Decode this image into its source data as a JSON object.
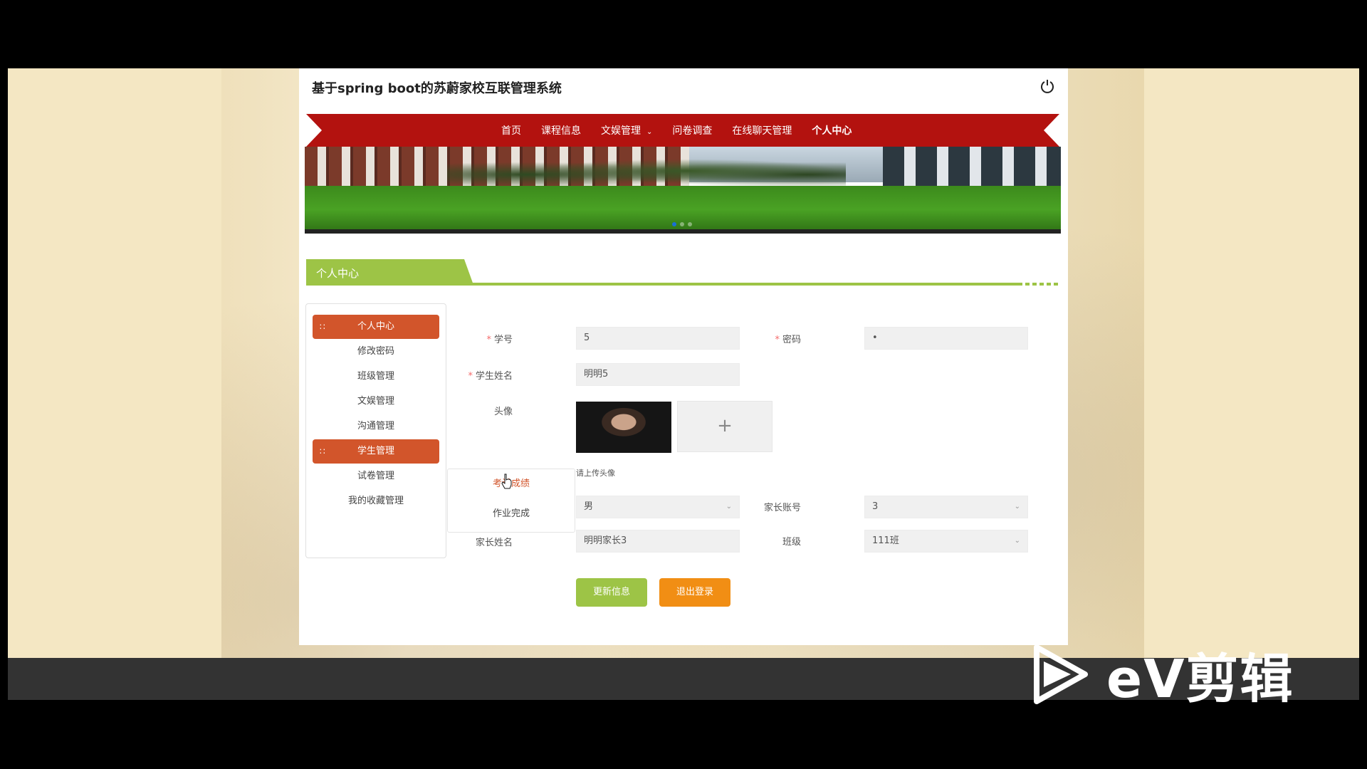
{
  "app": {
    "title": "基于spring boot的苏蔚家校互联管理系统"
  },
  "nav": {
    "items": [
      {
        "label": "首页",
        "active": false,
        "has_dropdown": false
      },
      {
        "label": "课程信息",
        "active": false,
        "has_dropdown": false
      },
      {
        "label": "文娱管理",
        "active": false,
        "has_dropdown": true
      },
      {
        "label": "问卷调查",
        "active": false,
        "has_dropdown": false
      },
      {
        "label": "在线聊天管理",
        "active": false,
        "has_dropdown": false
      },
      {
        "label": "个人中心",
        "active": true,
        "has_dropdown": false
      }
    ]
  },
  "banner": {
    "slide_count": 3,
    "active_slide": 1
  },
  "section": {
    "title": "个人中心"
  },
  "side_menu": {
    "items": [
      {
        "label": "个人中心",
        "active": true
      },
      {
        "label": "修改密码",
        "active": false
      },
      {
        "label": "班级管理",
        "active": false
      },
      {
        "label": "文娱管理",
        "active": false
      },
      {
        "label": "沟通管理",
        "active": false
      },
      {
        "label": "学生管理",
        "active": true
      },
      {
        "label": "试卷管理",
        "active": false
      },
      {
        "label": "我的收藏管理",
        "active": false
      }
    ],
    "submenu": [
      {
        "label": "考试成绩",
        "hover": true
      },
      {
        "label": "作业完成",
        "hover": false
      }
    ]
  },
  "form": {
    "student_id": {
      "label": "学号",
      "required": true,
      "value": "5"
    },
    "password": {
      "label": "密码",
      "required": true,
      "value": "•"
    },
    "student_name": {
      "label": "学生姓名",
      "required": true,
      "value": "明明5"
    },
    "avatar": {
      "label": "头像",
      "upload_tip": "请上传头像",
      "upload_icon": "plus-icon"
    },
    "gender": {
      "value": "男"
    },
    "parent_account": {
      "label": "家长账号",
      "value": "3"
    },
    "parent_name": {
      "label": "家长姓名",
      "value": "明明家长3"
    },
    "class": {
      "label": "班级",
      "value": "111班"
    }
  },
  "buttons": {
    "update": "更新信息",
    "logout": "退出登录"
  },
  "watermark": {
    "text": "eV剪辑"
  },
  "colors": {
    "nav_red": "#b3120f",
    "menu_active": "#d2552b",
    "section_green": "#9dc446",
    "logout_orange": "#f18e14",
    "required_red": "#f56c6c"
  }
}
